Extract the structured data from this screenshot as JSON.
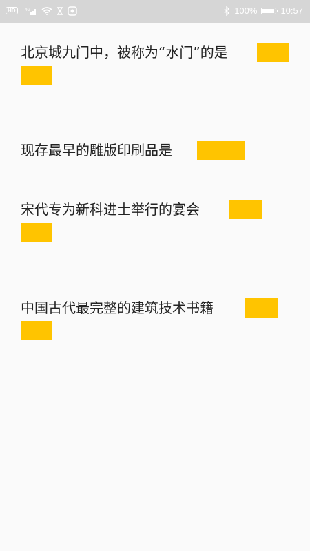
{
  "status_bar": {
    "network_badge": "HD",
    "signal_label": "4G",
    "bluetooth_icon": "bluetooth-icon",
    "battery_percent": "100%",
    "battery_level": 1.0,
    "time": "10:57"
  },
  "quiz": {
    "questions": [
      {
        "text": "北京城九门中，被称为“水门”的是"
      },
      {
        "text": "现存最早的雕版印刷品是"
      },
      {
        "text": "宋代专为新科进士举行的宴会"
      },
      {
        "text": "中国古代最完整的建筑技术书籍"
      }
    ],
    "answer_color": "#ffc400",
    "background": "#fafafa"
  }
}
